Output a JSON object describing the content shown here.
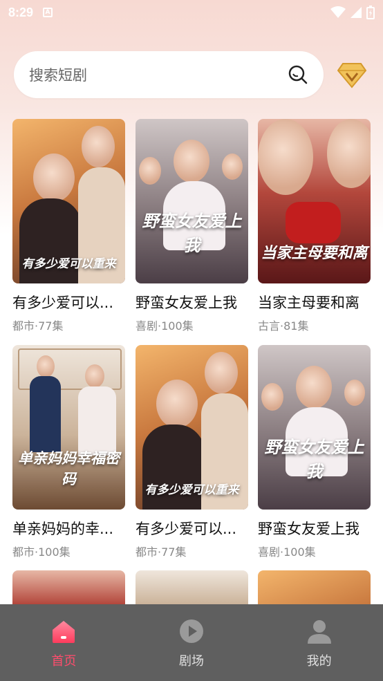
{
  "status_bar": {
    "time": "8:29",
    "a_label": "A"
  },
  "search": {
    "placeholder": "搜索短剧"
  },
  "dramas": [
    {
      "title": "有多少爱可以...",
      "meta": "都市·77集",
      "poster_text": "有多少爱可以重来"
    },
    {
      "title": "野蛮女友爱上我",
      "meta": "喜剧·100集",
      "poster_text": "野蛮女友爱上我"
    },
    {
      "title": "当家主母要和离",
      "meta": "古言·81集",
      "poster_text": "当家主母要和离"
    },
    {
      "title": "单亲妈妈的幸...",
      "meta": "都市·100集",
      "poster_text": "单亲妈妈幸福密码"
    },
    {
      "title": "有多少爱可以...",
      "meta": "都市·77集",
      "poster_text": "有多少爱可以重来"
    },
    {
      "title": "野蛮女友爱上我",
      "meta": "喜剧·100集",
      "poster_text": "野蛮女友爱上我"
    }
  ],
  "tabs": [
    {
      "label": "首页",
      "icon": "home-icon",
      "active": true
    },
    {
      "label": "剧场",
      "icon": "play-icon",
      "active": false
    },
    {
      "label": "我的",
      "icon": "profile-icon",
      "active": false
    }
  ],
  "colors": {
    "accent": "#ff4d6d",
    "tabbar_bg": "#5f5f5f",
    "vip_gold": "#e7b34a"
  }
}
